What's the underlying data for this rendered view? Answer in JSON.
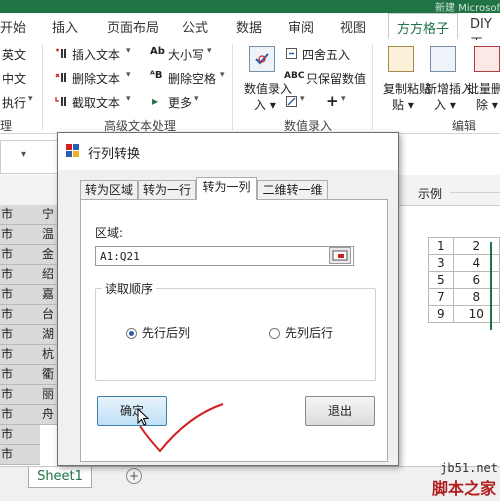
{
  "titlebar": {
    "text": "新建 Microsof"
  },
  "tabs": [
    {
      "label": "开始"
    },
    {
      "label": "插入"
    },
    {
      "label": "页面布局"
    },
    {
      "label": "公式"
    },
    {
      "label": "数据"
    },
    {
      "label": "审阅"
    },
    {
      "label": "视图"
    },
    {
      "label": "方方格子"
    },
    {
      "label": "DIY工"
    }
  ],
  "ribbon": {
    "left_items": [
      "英文",
      "中文",
      "执行"
    ],
    "left_group": "理",
    "text_group": {
      "items": [
        "插入文本",
        "删除文本",
        "截取文本",
        "大小写",
        "删除空格",
        "更多"
      ],
      "label": "高级文本处理"
    },
    "number_group": {
      "big_button": "数值录入",
      "items": [
        "四舍五入",
        "只保留数值"
      ],
      "label": "数值录入"
    },
    "edit_group": {
      "items": [
        "复制粘贴",
        "新增插入",
        "批量删除"
      ],
      "label": "编辑"
    }
  },
  "sheet": {
    "col_cells": [
      "市",
      "市",
      "市",
      "市",
      "市",
      "市",
      "市",
      "市",
      "市",
      "市",
      "市",
      "市",
      "市"
    ],
    "col2_cells": [
      "宁",
      "温",
      "金",
      "绍",
      "嘉",
      "台",
      "湖",
      "杭",
      "衢",
      "丽",
      "舟"
    ],
    "sheet_tab": "Sheet1",
    "add_sheet": "+"
  },
  "dialog": {
    "title": "行列转换",
    "tabs": [
      "转为区域",
      "转为一行",
      "转为一列",
      "二维转一维"
    ],
    "selected_tab": "转为一列",
    "range_label": "区域:",
    "range_value": "A1:Q21",
    "order_legend": "读取顺序",
    "options": [
      {
        "label": "先行后列",
        "checked": true
      },
      {
        "label": "先列后行",
        "checked": false
      }
    ],
    "ok": "确定",
    "cancel": "退出"
  },
  "sample": {
    "label": "示例",
    "rows": [
      [
        "1",
        "2"
      ],
      [
        "3",
        "4"
      ],
      [
        "5",
        "6"
      ],
      [
        "7",
        "8"
      ],
      [
        "9",
        "10"
      ]
    ]
  },
  "watermark": {
    "site": "jb51.net",
    "name": "脚本之家"
  },
  "colors": {
    "accent": "#1f7345",
    "check_mark": "#d42020"
  }
}
